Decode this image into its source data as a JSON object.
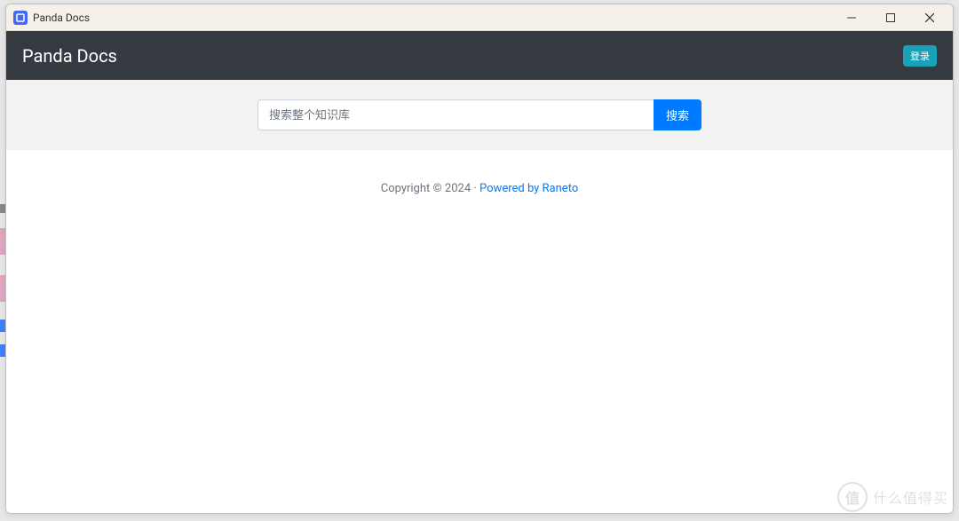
{
  "window": {
    "title": "Panda Docs"
  },
  "navbar": {
    "brand": "Panda Docs",
    "login_label": "登录"
  },
  "search": {
    "placeholder": "搜索整个知识库",
    "button_label": "搜索"
  },
  "footer": {
    "copyright": "Copyright © 2024 · ",
    "powered_by": "Powered by Raneto"
  },
  "watermark": {
    "badge": "值",
    "text": "什么值得买"
  }
}
